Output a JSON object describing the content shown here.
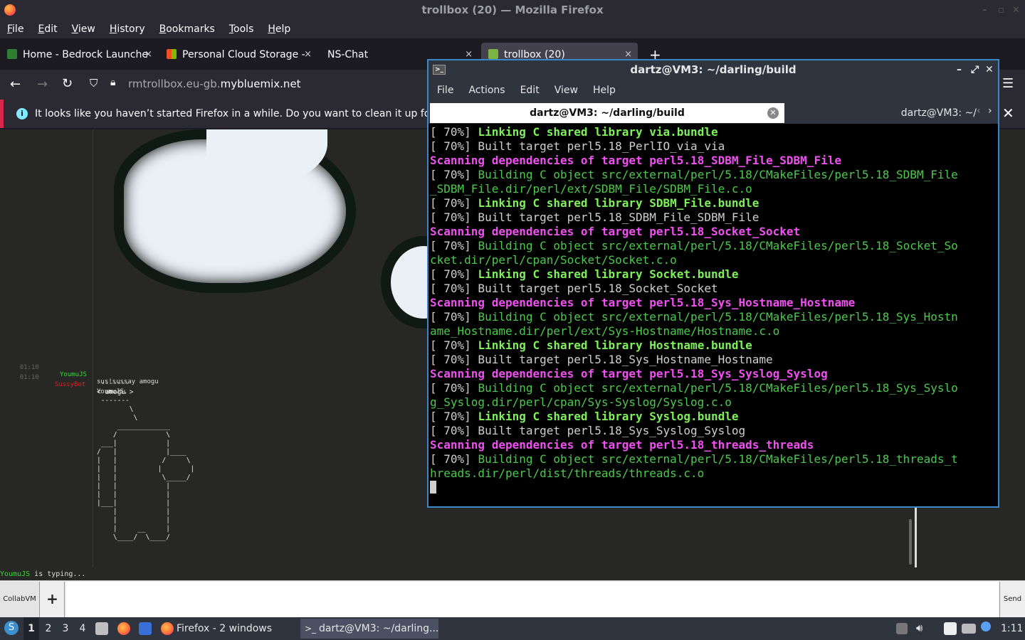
{
  "firefox": {
    "window_title": "trollbox (20) — Mozilla Firefox",
    "menu": [
      "File",
      "Edit",
      "View",
      "History",
      "Bookmarks",
      "Tools",
      "Help"
    ],
    "tabs": [
      {
        "label": "Home - Bedrock Launche",
        "close": "×"
      },
      {
        "label": "Personal Cloud Storage -",
        "close": "×"
      },
      {
        "label": "NS-Chat",
        "close": "×"
      },
      {
        "label": "trollbox (20)",
        "close": "×"
      }
    ],
    "new_tab": "+",
    "url_prefix": "rmtrollbox.eu-gb.",
    "url_domain": "mybluemix.net",
    "notification": "It looks like you haven’t started Firefox in a while. Do you want to clean it up for a f",
    "notification_close": "✕"
  },
  "chat": {
    "messages": [
      {
        "time": "01:10",
        "user": "YoumuJS",
        "text": "sus!sussay amogu",
        "user_color": "#33dd33"
      },
      {
        "time": "01:10",
        "user": "SussyBot",
        "text": "YoumuJS,",
        "user_color": "#dd2222"
      }
    ],
    "ascii_art": " -------\n< amogu >\n -------\n        \\\n         \\\n     _____________\n    /            \\\n ___|            |\n/   |            |____\n|   |           /     \\\n|   |          |       |\n|   |           \\_____/\n|   |            |\n|   |            |\n|___|            |\n    |            |\n    |            |\n    |     __     |\n    \\____/  \\____/",
    "typing_user": "YoumuJS",
    "typing_text": " is typing...",
    "collab_label": "CollabVM",
    "plus_label": "+",
    "send_label": "Send"
  },
  "terminal": {
    "title": "dartz@VM3: ~/darling/build",
    "menu": [
      "File",
      "Actions",
      "Edit",
      "View",
      "Help"
    ],
    "tab_active": "dartz@VM3: ~/darling/build",
    "tab_other": "dartz@VM3: ~/",
    "lines": [
      [
        {
          "t": "[ 70%] ",
          "c": "wb"
        },
        {
          "t": "Linking C shared library via.bundle",
          "c": "gb"
        }
      ],
      [
        {
          "t": "[ 70%] Built target perl5.18_PerlIO_via_via",
          "c": "wb"
        }
      ],
      [
        {
          "t": "Scanning dependencies of target perl5.18_SDBM_File_SDBM_File",
          "c": "m"
        }
      ],
      [
        {
          "t": "[ 70%] ",
          "c": "wb"
        },
        {
          "t": "Building C object src/external/perl/5.18/CMakeFiles/perl5.18_SDBM_File",
          "c": "g"
        }
      ],
      [
        {
          "t": "_SDBM_File.dir/perl/ext/SDBM_File/SDBM_File.c.o",
          "c": "g"
        }
      ],
      [
        {
          "t": "[ 70%] ",
          "c": "wb"
        },
        {
          "t": "Linking C shared library SDBM_File.bundle",
          "c": "gb"
        }
      ],
      [
        {
          "t": "[ 70%] Built target perl5.18_SDBM_File_SDBM_File",
          "c": "wb"
        }
      ],
      [
        {
          "t": "Scanning dependencies of target perl5.18_Socket_Socket",
          "c": "m"
        }
      ],
      [
        {
          "t": "[ 70%] ",
          "c": "wb"
        },
        {
          "t": "Building C object src/external/perl/5.18/CMakeFiles/perl5.18_Socket_So",
          "c": "g"
        }
      ],
      [
        {
          "t": "cket.dir/perl/cpan/Socket/Socket.c.o",
          "c": "g"
        }
      ],
      [
        {
          "t": "[ 70%] ",
          "c": "wb"
        },
        {
          "t": "Linking C shared library Socket.bundle",
          "c": "gb"
        }
      ],
      [
        {
          "t": "[ 70%] Built target perl5.18_Socket_Socket",
          "c": "wb"
        }
      ],
      [
        {
          "t": "Scanning dependencies of target perl5.18_Sys_Hostname_Hostname",
          "c": "m"
        }
      ],
      [
        {
          "t": "[ 70%] ",
          "c": "wb"
        },
        {
          "t": "Building C object src/external/perl/5.18/CMakeFiles/perl5.18_Sys_Hostn",
          "c": "g"
        }
      ],
      [
        {
          "t": "ame_Hostname.dir/perl/ext/Sys-Hostname/Hostname.c.o",
          "c": "g"
        }
      ],
      [
        {
          "t": "[ 70%] ",
          "c": "wb"
        },
        {
          "t": "Linking C shared library Hostname.bundle",
          "c": "gb"
        }
      ],
      [
        {
          "t": "[ 70%] Built target perl5.18_Sys_Hostname_Hostname",
          "c": "wb"
        }
      ],
      [
        {
          "t": "Scanning dependencies of target perl5.18_Sys_Syslog_Syslog",
          "c": "m"
        }
      ],
      [
        {
          "t": "[ 70%] ",
          "c": "wb"
        },
        {
          "t": "Building C object src/external/perl/5.18/CMakeFiles/perl5.18_Sys_Syslo",
          "c": "g"
        }
      ],
      [
        {
          "t": "g_Syslog.dir/perl/cpan/Sys-Syslog/Syslog.c.o",
          "c": "g"
        }
      ],
      [
        {
          "t": "[ 70%] ",
          "c": "wb"
        },
        {
          "t": "Linking C shared library Syslog.bundle",
          "c": "gb"
        }
      ],
      [
        {
          "t": "[ 70%] Built target perl5.18_Sys_Syslog_Syslog",
          "c": "wb"
        }
      ],
      [
        {
          "t": "Scanning dependencies of target perl5.18_threads_threads",
          "c": "m"
        }
      ],
      [
        {
          "t": "[ 70%] ",
          "c": "wb"
        },
        {
          "t": "Building C object src/external/perl/5.18/CMakeFiles/perl5.18_threads_t",
          "c": "g"
        }
      ],
      [
        {
          "t": "hreads.dir/perl/dist/threads/threads.c.o",
          "c": "g"
        }
      ]
    ]
  },
  "taskbar": {
    "workspaces": [
      "1",
      "2",
      "3",
      "4"
    ],
    "tasks": [
      "Firefox - 2 windows",
      "dartz@VM3: ~/darling..."
    ],
    "clock": "1:11"
  },
  "colors": {
    "terminal_border": "#3a87c9",
    "term_green_bold": "#7ff05a",
    "term_green": "#4cc94c",
    "term_magenta": "#f050f0",
    "notification_accent": "#d7264c"
  }
}
